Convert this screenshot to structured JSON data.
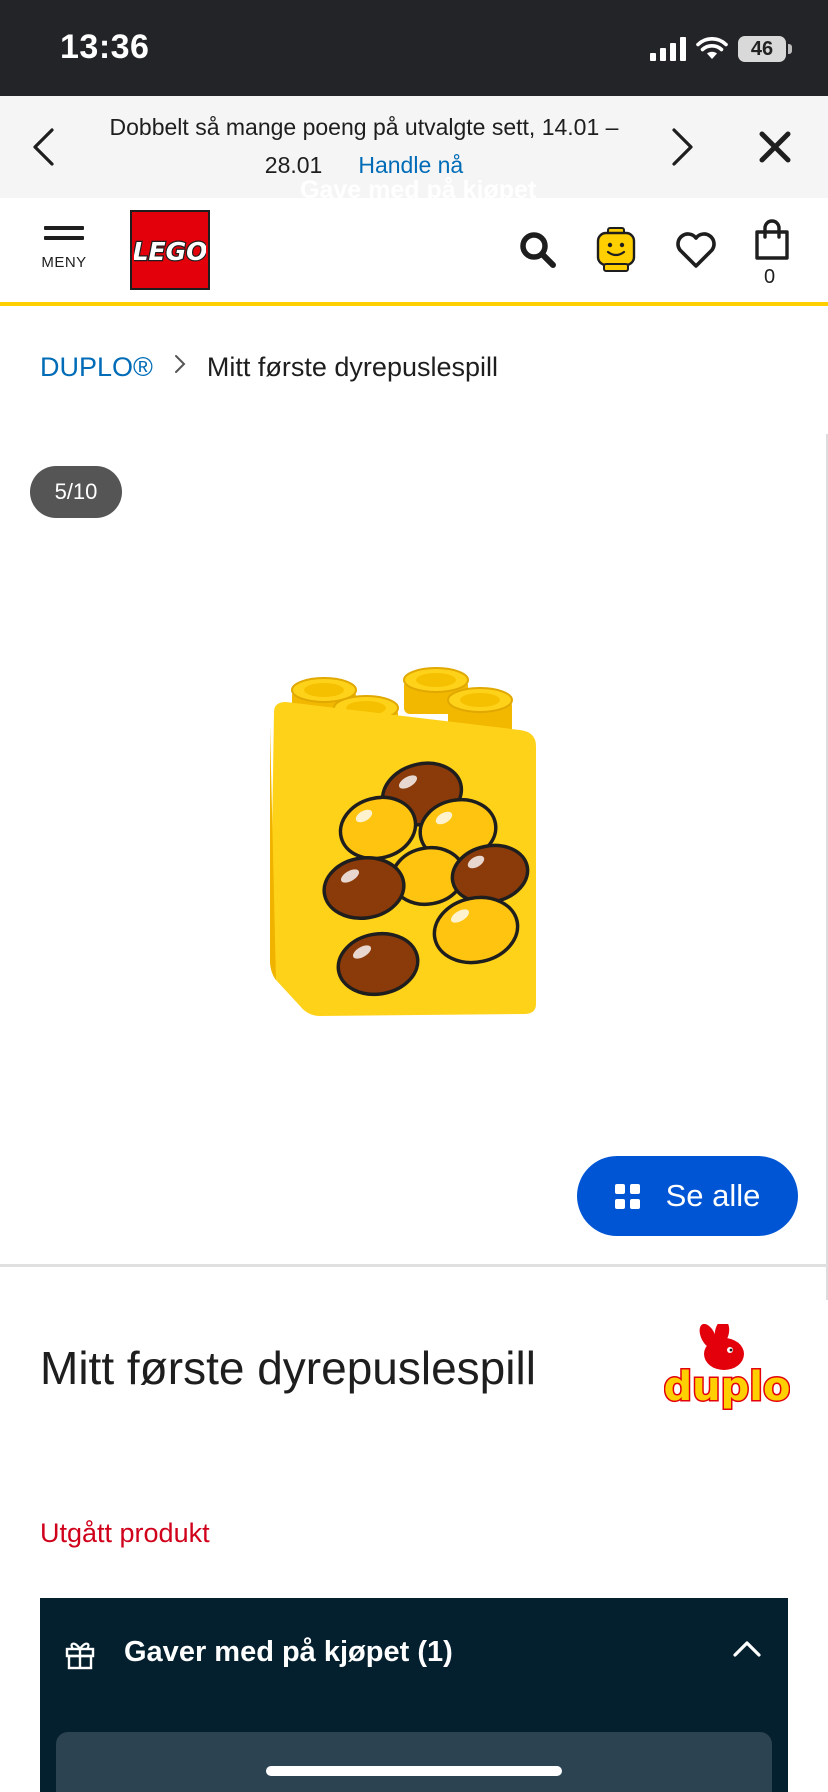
{
  "status_bar": {
    "time": "13:36",
    "battery": "46"
  },
  "promo": {
    "text": "Dobbelt så mange poeng på utvalgte sett, 14.01 – 28.01",
    "link": "Handle nå"
  },
  "header": {
    "menu_label": "MENY",
    "logo_text": "LEGO",
    "bag_count": "0"
  },
  "breadcrumb": {
    "parent": "DUPLO®",
    "current": "Mitt første dyrepuslespill"
  },
  "gallery": {
    "counter": "5/10",
    "see_all": "Se alle"
  },
  "product": {
    "title": "Mitt første dyrepuslespill",
    "brand_logo": "duplo",
    "status": "Utgått produkt"
  },
  "gifts": {
    "title": "Gaver med på kjøpet (1)",
    "card_label": "Gave med på kjøpet"
  },
  "colors": {
    "accent_blue": "#0055d4",
    "link_blue": "#006cb7",
    "lego_red": "#e3000b",
    "lego_yellow": "#ffcf00",
    "status_red": "#d0021b",
    "gifts_bg": "#04202f"
  }
}
